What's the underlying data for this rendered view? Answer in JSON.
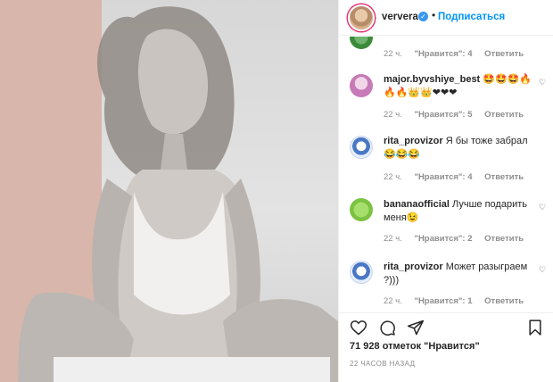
{
  "post": {
    "username": "ververa",
    "follow_label": "Подписаться",
    "dot": "•",
    "verified_mark": "✓"
  },
  "comments": [
    {
      "username": "",
      "text": "",
      "time": "22 ч.",
      "likes": "\"Нравится\": 4",
      "reply": "Ответить",
      "avatar_color": "#3a8a3a"
    },
    {
      "username": "major.byvshiye_best",
      "text": "🤩🤩🤩🔥",
      "text_line2": "🔥🔥👑👑❤❤❤",
      "time": "22 ч.",
      "likes": "\"Нравится\": 5",
      "reply": "Ответить",
      "avatar_color": "#c77ab8"
    },
    {
      "username": "rita_provizor",
      "text": "Я бы тоже забрал",
      "text_line2": "😂😂😂",
      "time": "22 ч.",
      "likes": "\"Нравится\": 4",
      "reply": "Ответить",
      "avatar_color": "#4a78c4"
    },
    {
      "username": "bananaofficial",
      "text": "Лучше подарить",
      "text_line2": "меня😉",
      "time": "22 ч.",
      "likes": "\"Нравится\": 2",
      "reply": "Ответить",
      "avatar_color": "#7cc242"
    },
    {
      "username": "rita_provizor",
      "text": "Может разыграем",
      "text_line2": "?)))",
      "time": "22 ч.",
      "likes": "\"Нравится\": 1",
      "reply": "Ответить",
      "avatar_color": "#4a78c4"
    }
  ],
  "footer": {
    "likes_total": "71 928 отметок \"Нравится\"",
    "timestamp": "22 ЧАСОВ НАЗАД"
  },
  "icons": {
    "like": "heart-icon",
    "comment": "comment-icon",
    "share": "share-icon",
    "save": "bookmark-icon",
    "comment_like": "heart-icon"
  },
  "colors": {
    "link": "#0095f6",
    "muted": "#8e8e8e",
    "text": "#262626",
    "photo_tint": "#d9b6ab"
  }
}
